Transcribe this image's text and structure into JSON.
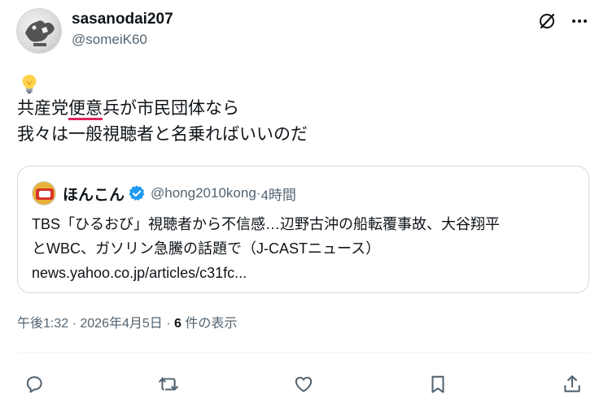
{
  "author": {
    "display_name": "sasanodai207",
    "handle": "@someiK60"
  },
  "tweet": {
    "emoji": "💡",
    "line1_prefix": "共産党",
    "line1_underlined": "便意",
    "line1_suffix": "兵が市民団体なら",
    "line2": "我々は一般視聴者と名乗ればいいのだ"
  },
  "quoted": {
    "display_name": "ほんこん",
    "handle": "@hong2010kong",
    "separator": " · ",
    "time": "4時間",
    "text_line1": "TBS「ひるおび」視聴者から不信感…辺野古沖の船転覆事故、大谷翔平",
    "text_line2": "とWBC、ガソリン急騰の話題で（J-CASTニュース）",
    "text_line3": "news.yahoo.co.jp/articles/c31fc..."
  },
  "meta": {
    "time": "午後1:32",
    "sep1": " · ",
    "date": "2026年4月5日",
    "sep2": " · ",
    "views_count": "6",
    "views_label": " 件の表示"
  },
  "icons": {
    "grok": "grok-icon",
    "more": "more-icon",
    "reply": "reply-icon",
    "retweet": "retweet-icon",
    "like": "heart-icon",
    "bookmark": "bookmark-icon",
    "share": "share-icon",
    "verified": "verified-badge-icon"
  },
  "colors": {
    "text_primary": "#0f1419",
    "text_secondary": "#536471",
    "border": "#cfd9de",
    "verified_blue": "#1d9bf0",
    "underline_red": "#e0245e"
  }
}
